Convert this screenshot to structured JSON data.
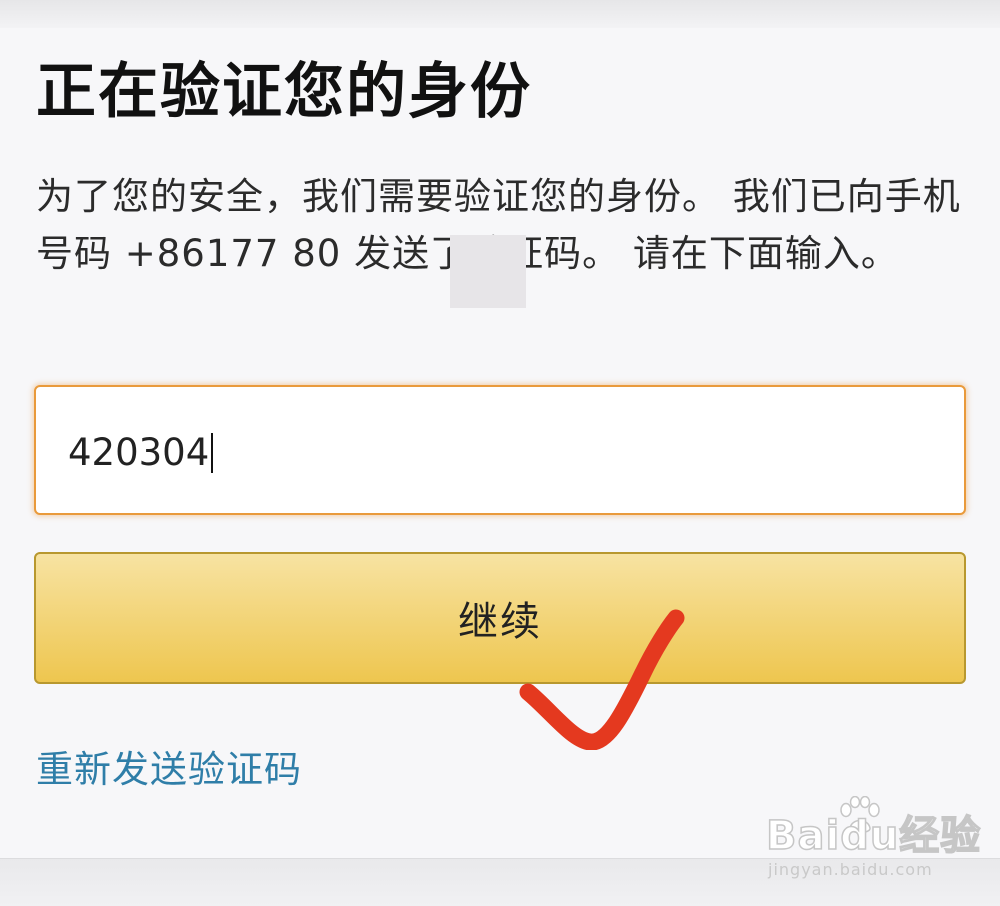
{
  "page": {
    "title": "正在验证您的身份",
    "description": "为了您的安全，我们需要验证您的身份。 我们已向手机号码 +86177        80 发送了验证码。 请在下面输入。",
    "code_value": "420304",
    "continue_label": "继续",
    "resend_label": "重新发送验证码"
  },
  "watermark": {
    "logo_text": "Baidu经验",
    "url": "jingyan.baidu.com"
  },
  "colors": {
    "input_focus_border": "#e99a3b",
    "button_gradient_top": "#f7e3a2",
    "button_gradient_bottom": "#eec64f",
    "link": "#2f7ea8",
    "annotation_checkmark": "#e4391f"
  }
}
